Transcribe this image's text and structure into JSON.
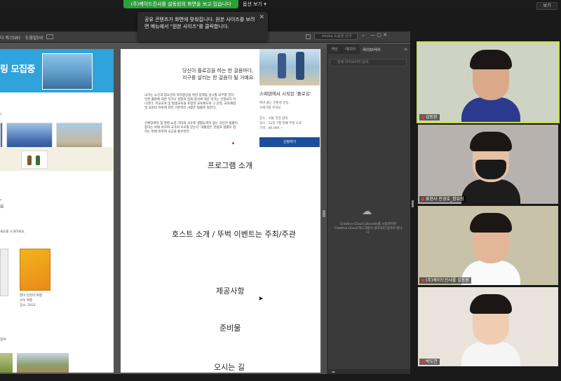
{
  "meeting": {
    "share_banner": "(주)케이드진사를 설동원의 화면을 보고 있습니다",
    "options_menu": "옵션 보기 ▾",
    "view_button": "보기",
    "notice_text": "공유 콘텐츠가 화면에 맞춰집니다. 원본 사이즈를 보려면 메뉴에서 \"원본 사이즈\"를 클릭합니다.",
    "notice_close": "✕"
  },
  "app_toolbar": {
    "window_label": "다 워크(W)",
    "help_label": "도움말(H)",
    "search_placeholder": "Adobe 도움말 검색"
  },
  "left_page": {
    "banner_title": "링 모집중",
    "small_q": "?",
    "arrow_glyph": "›",
    "label_ok": "요",
    "small_caption_1": "세요를 소개하세요.",
    "small_caption_2": "발마 천천리 여행",
    "small_caption_3": "산속 여행",
    "small_caption_4": "장소: 2022",
    "small_caption_5": "참여"
  },
  "mid_page": {
    "line1": "당신이 플로깅을 하는 한 걸음마다,",
    "line2": "지구를 살리는 한 걸음이 될 거예요.",
    "para1": "국가는 노인과 청소년의 복지향상을 위한 정책을 실시할 의무를 진다. 언론·출판에 대한 허가나 검열과 집회·결사에 대한 허가는 인정되지 아니한다. 학교교육 및 평생교육을 포함한 교육제도와 그 운영, 교육재정 및 교원의 지위에 관한 기본적인 사항은 법률로 정한다.",
    "para2": "신체장애자 및 질병·노령 기타의 사유로 생활능력이 없는 국민은 법률이 정하는 바에 의하여 국가의 보호를 받는다. 대통령은 헌법과 법률이 정하는 바에 의하여 국군을 통수한다.",
    "right_title": "스웨덴에서 시작된 '플로깅'",
    "right_small_1": "뛰며 줍는 친환경 운동,",
    "right_small_2": "쓰레기를 주워요",
    "right_small_3": "장소 : 서울 한강 일대",
    "right_small_4": "일시 : 22년 7월 첫째 주말 오후",
    "right_small_5": "가격 : 80,000 ~",
    "apply_button": "신청하기",
    "heading_program": "프로그램 소개",
    "heading_host": "호스트 소개 / 뚜벅 이벤트는 주최/주관",
    "heading_provided": "제공사항",
    "heading_prepare": "준비물",
    "heading_directions": "오시는 길",
    "cursor": "➤"
  },
  "panel": {
    "tabs": [
      "색상",
      "레이어",
      "라이브러리"
    ],
    "search_placeholder": "현재 라이브러리 검색",
    "cc_icon": "☁",
    "cc_message": "Creative Cloud Libraries를 사용하려면 Creative Cloud 데스크탑이 설치되어 있어야 합니다."
  },
  "participants": [
    {
      "name": "김동완",
      "bg": "#cfd3c4",
      "face": "#d9a98a",
      "shirt": "#2b3a8f"
    },
    {
      "name": "표현사 안경호_정유림",
      "bg": "#b8b2ae",
      "face": "#e5c2a6",
      "shirt": "#1d1d1d"
    },
    {
      "name": "(주)케이드진사를 설동원",
      "bg": "#c8c2a8",
      "face": "#e2b696",
      "shirt": "#fafafa"
    },
    {
      "name": "박도연",
      "bg": "#e9e3dc",
      "face": "#efcdb2",
      "shirt": "#f5f5f5"
    }
  ]
}
